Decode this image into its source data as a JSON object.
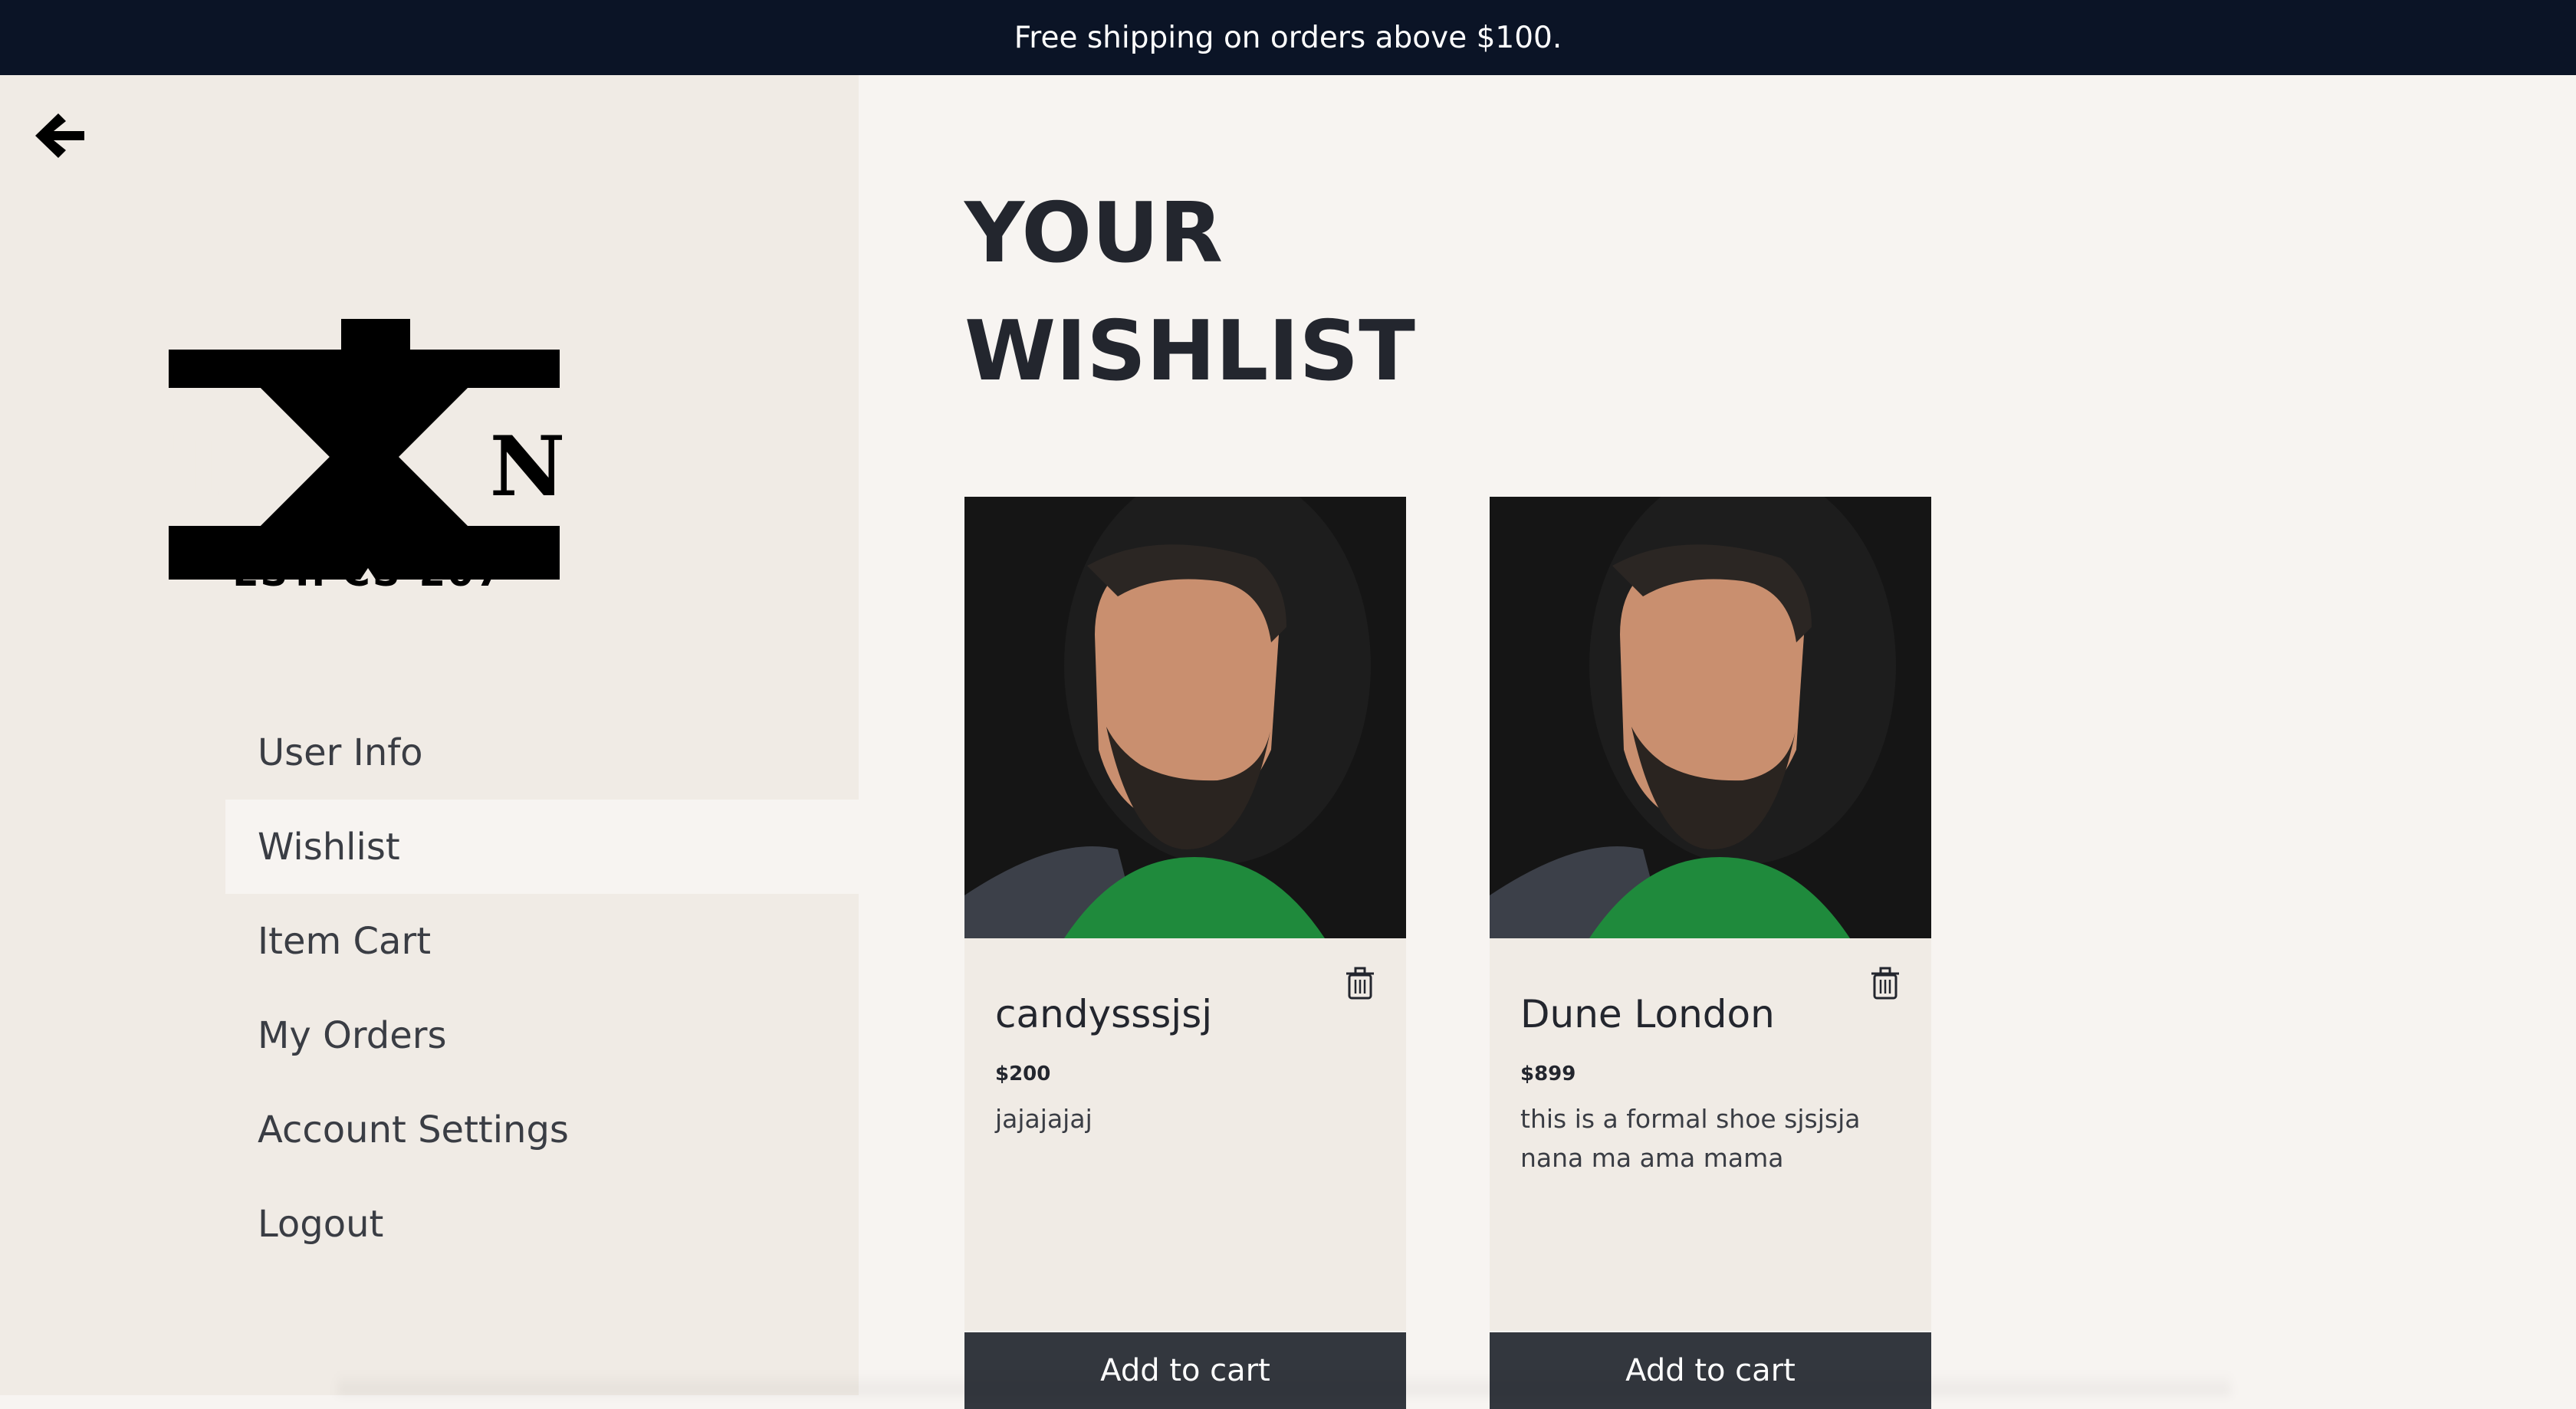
{
  "banner": {
    "text": "Free shipping on orders above $100."
  },
  "sidebar": {
    "back_icon": "arrow-left-icon",
    "logo": {
      "left_letter": "T",
      "right_letter": "N",
      "center_letter": "X",
      "est_text": "EST. CS-207"
    },
    "items": [
      {
        "label": "User Info",
        "active": false
      },
      {
        "label": "Wishlist",
        "active": true
      },
      {
        "label": "Item Cart",
        "active": false
      },
      {
        "label": "My Orders",
        "active": false
      },
      {
        "label": "Account Settings",
        "active": false
      },
      {
        "label": "Logout",
        "active": false
      }
    ]
  },
  "main": {
    "title_line1": "YOUR",
    "title_line2": "WISHLIST",
    "wishlist": [
      {
        "name": "candysssjsj",
        "price": "$200",
        "description": "jajajajaj",
        "add_label": "Add to cart",
        "delete_icon": "trash-icon"
      },
      {
        "name": "Dune London",
        "price": "$899",
        "description": "this is a formal shoe sjsjsja nana ma ama mama",
        "add_label": "Add to cart",
        "delete_icon": "trash-icon"
      }
    ]
  },
  "colors": {
    "banner_bg": "#0b1426",
    "sidebar_bg": "#f0ebe5",
    "main_bg": "#f7f4f1",
    "button_bg": "#33373e",
    "text_dark": "#23262e"
  }
}
